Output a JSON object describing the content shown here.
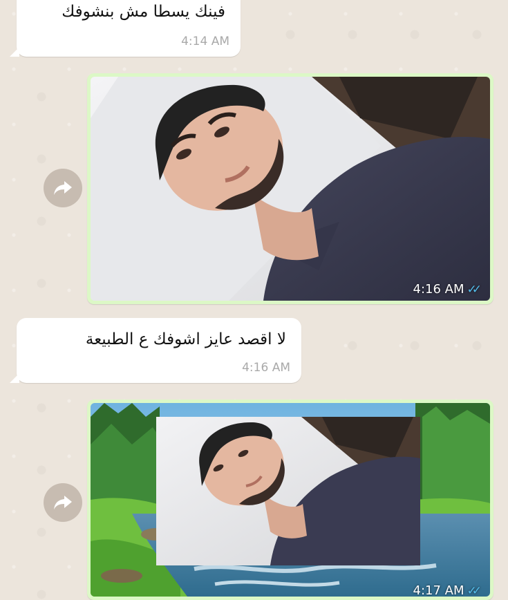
{
  "messages": [
    {
      "direction": "incoming",
      "text": "فينك يسطا مش بنشوفك",
      "time": "4:14 AM"
    },
    {
      "direction": "outgoing",
      "kind": "photo",
      "time": "4:16 AM",
      "status_icon": "double-check-read-icon"
    },
    {
      "direction": "incoming",
      "text": "لا اقصد عايز اشوفك ع الطبيعة",
      "time": "4:16 AM"
    },
    {
      "direction": "outgoing",
      "kind": "photo",
      "time": "4:17 AM",
      "status_icon": "double-check-read-icon"
    }
  ],
  "ticks": "✓✓",
  "forward_icon": "forward-arrow-icon",
  "colors": {
    "chat_background": "#ece5dc",
    "incoming_bubble": "#ffffff",
    "outgoing_bubble": "#dcf8c6",
    "read_ticks": "#53bdeb",
    "forward_button": "#c7bcb1"
  }
}
